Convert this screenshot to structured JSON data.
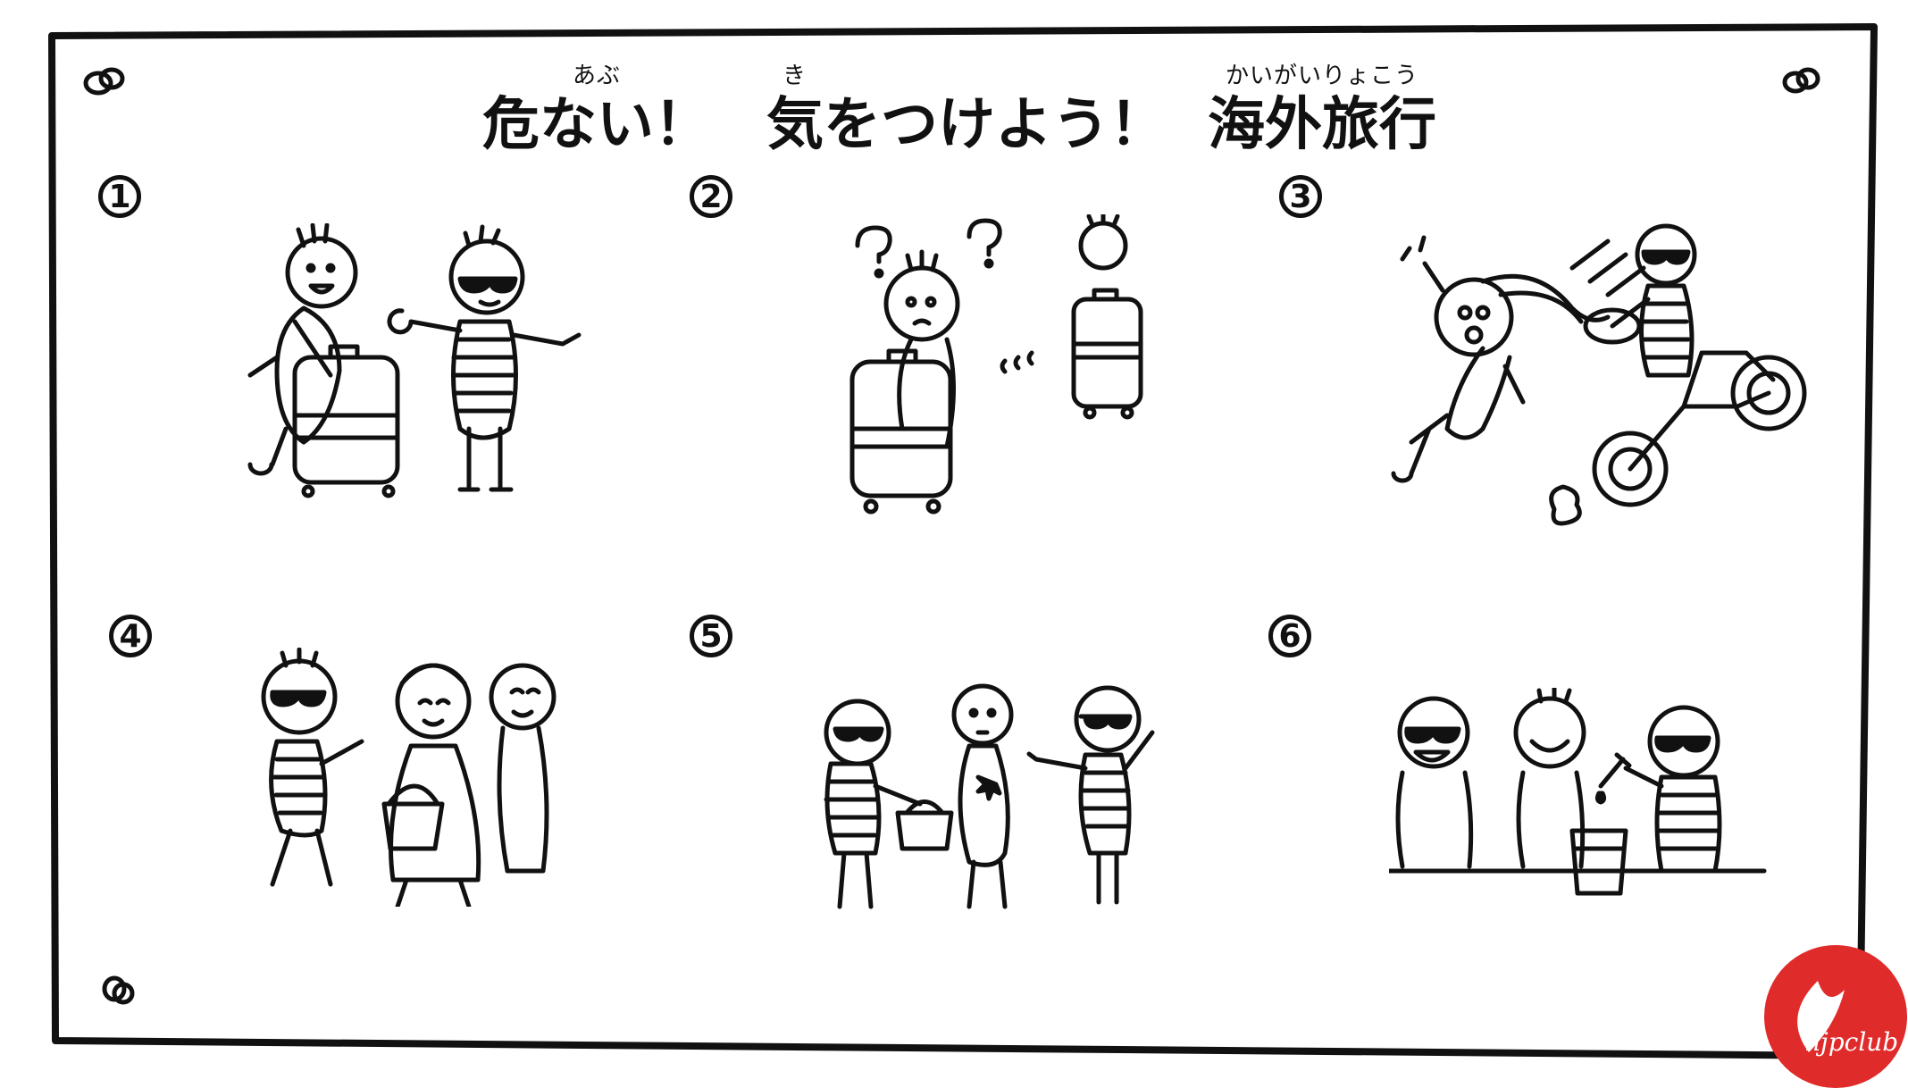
{
  "title": {
    "seg1_ruby": "あぶ",
    "seg1_text": "危ない！",
    "seg2_ruby": "き",
    "seg2_text": "気をつけよう！",
    "seg3_ruby": "かいがいりょこう",
    "seg3_text": "海外旅行"
  },
  "panels": [
    {
      "number": "1"
    },
    {
      "number": "2"
    },
    {
      "number": "3"
    },
    {
      "number": "4"
    },
    {
      "number": "5"
    },
    {
      "number": "6"
    }
  ],
  "watermark": {
    "text": "njpclub",
    "color": "#e02b2b"
  }
}
